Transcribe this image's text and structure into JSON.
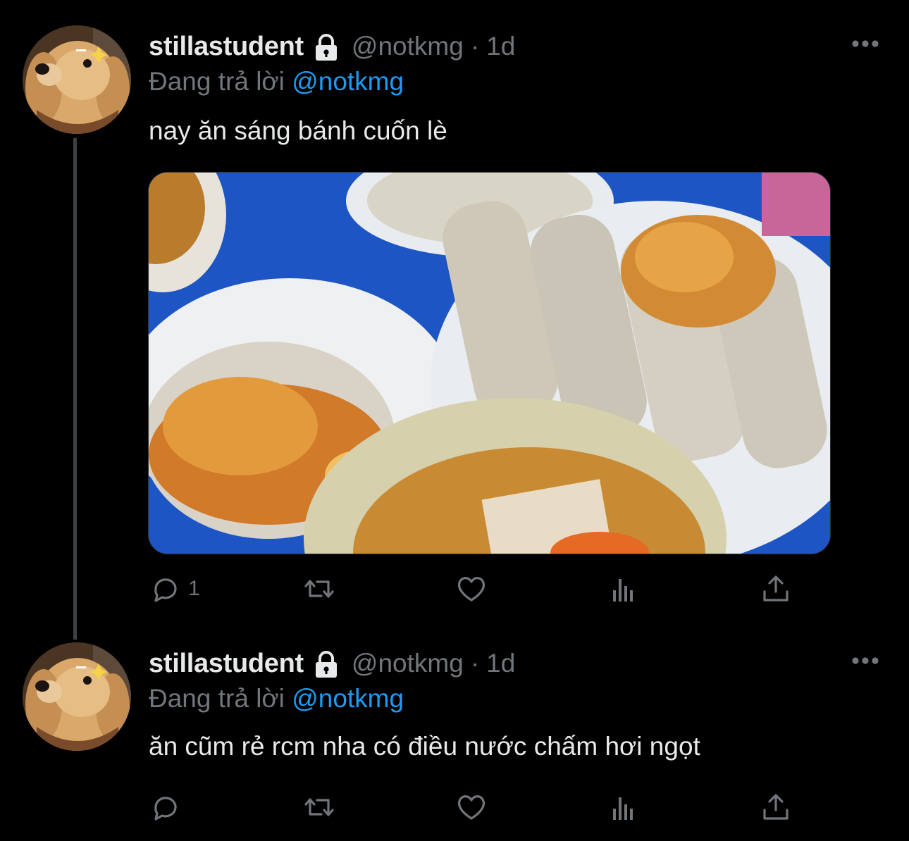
{
  "tweets": [
    {
      "display_name": "stillastudent",
      "handle": "@notkmg",
      "separator": "·",
      "time": "1d",
      "reply_prefix": "Đang trả lời",
      "reply_mention": "@notkmg",
      "text": "nay ăn sáng bánh cuốn lè",
      "reply_count": "1",
      "has_media": true
    },
    {
      "display_name": "stillastudent",
      "handle": "@notkmg",
      "separator": "·",
      "time": "1d",
      "reply_prefix": "Đang trả lời",
      "reply_mention": "@notkmg",
      "text": "ăn cũm rẻ rcm nha có điều nước chấm hơi ngọt",
      "reply_count": "",
      "has_media": false
    }
  ],
  "icons": {
    "avatar": "golden-retriever-avatar",
    "lock": "lock-icon",
    "more": "more-icon",
    "reply": "reply-icon",
    "retweet": "retweet-icon",
    "like": "heart-icon",
    "views": "analytics-icon",
    "share": "share-icon"
  },
  "colors": {
    "background": "#000000",
    "primary_text": "#e7e9ea",
    "secondary_text": "#71767b",
    "accent": "#1d9bf0",
    "thread_line": "#3e4144"
  }
}
